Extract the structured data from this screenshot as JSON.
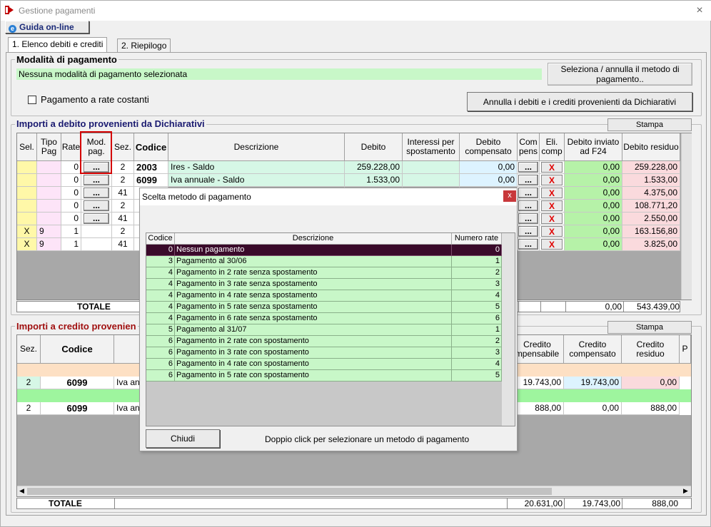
{
  "window": {
    "title": "Gestione pagamenti",
    "close_glyph": "×"
  },
  "toolbar": {
    "guida_label": "Guida on-line"
  },
  "tabs": [
    {
      "label": "1. Elenco debiti e crediti"
    },
    {
      "label": "2. Riepilogo"
    }
  ],
  "modalita": {
    "title": "Modalità di pagamento",
    "status": "Nessuna modalità di pagamento selezionata",
    "select_button": "Seleziona / annulla il metodo di pagamento..",
    "rate_costanti_label": "Pagamento a rate costanti",
    "annulla_button": "Annulla i debiti e i crediti provenienti da Dichiarativi"
  },
  "debiti": {
    "title": "Importi a debito provenienti da Dichiarativi",
    "stampa": "Stampa",
    "headers": [
      "Sel.",
      "Tipo Pag",
      "Rate",
      "Mod. pag.",
      "Sez.",
      "Codice",
      "Descrizione",
      "Debito",
      "Interessi per spostamento",
      "Debito compensato",
      "Com pens",
      "Eli. comp",
      "Debito inviato ad F24",
      "Debito residuo"
    ],
    "rows": [
      {
        "sel": "",
        "tipo": "",
        "rate": "0",
        "mod": "...",
        "sez": "2",
        "codice": "2003",
        "descr": "Ires - Saldo",
        "debito": "259.228,00",
        "compensato": "0,00",
        "inviato": "0,00",
        "residuo": "259.228,00"
      },
      {
        "sel": "",
        "tipo": "",
        "rate": "0",
        "mod": "...",
        "sez": "2",
        "codice": "6099",
        "descr": "Iva annuale - Saldo",
        "debito": "1.533,00",
        "compensato": "0,00",
        "inviato": "0,00",
        "residuo": "1.533,00"
      },
      {
        "sel": "",
        "tipo": "",
        "rate": "0",
        "mod": "...",
        "sez": "41",
        "codice": "",
        "descr": "",
        "debito": "",
        "compensato": "",
        "inviato": "0,00",
        "residuo": "4.375,00"
      },
      {
        "sel": "",
        "tipo": "",
        "rate": "0",
        "mod": "...",
        "sez": "2",
        "codice": "",
        "descr": "",
        "debito": "",
        "compensato": "",
        "inviato": "0,00",
        "residuo": "108.771,20"
      },
      {
        "sel": "",
        "tipo": "",
        "rate": "0",
        "mod": "...",
        "sez": "41",
        "codice": "",
        "descr": "",
        "debito": "",
        "compensato": "",
        "inviato": "0,00",
        "residuo": "2.550,00"
      },
      {
        "sel": "X",
        "tipo": "9",
        "rate": "1",
        "mod": "",
        "sez": "2",
        "codice": "",
        "descr": "",
        "debito": "",
        "compensato": "",
        "inviato": "0,00",
        "residuo": "163.156,80"
      },
      {
        "sel": "X",
        "tipo": "9",
        "rate": "1",
        "mod": "",
        "sez": "41",
        "codice": "",
        "descr": "",
        "debito": "",
        "compensato": "",
        "inviato": "0,00",
        "residuo": "3.825,00"
      }
    ],
    "compens_label": "...",
    "elimina_label": "X",
    "totale_label": "TOTALE",
    "totale_inviato": "0,00",
    "totale_residuo": "543.439,00"
  },
  "crediti": {
    "title": "Importi a credito provenien",
    "stampa": "Stampa",
    "headers": [
      "Sez.",
      "Codice",
      "Credito compensabile",
      "Credito compensato",
      "Credito residuo",
      "P"
    ],
    "header_compensabile_visible": "Credito mpensabile",
    "rows": [
      {
        "sez": "2",
        "codice": "6099",
        "descr": "Iva an",
        "compensabile": "19.743,00",
        "compensato": "19.743,00",
        "residuo": "0,00"
      },
      {
        "sez": "2",
        "codice": "6099",
        "descr": "Iva an",
        "compensabile": "888,00",
        "compensato": "0,00",
        "residuo": "888,00"
      }
    ],
    "totale_label": "TOTALE",
    "totale_compensabile": "20.631,00",
    "totale_compensato": "19.743,00",
    "totale_residuo": "888,00"
  },
  "modal": {
    "title": "Scelta metodo di pagamento",
    "close_glyph": "x",
    "headers": [
      "Codice",
      "Descrizione",
      "Numero rate"
    ],
    "rows": [
      {
        "codice": "0",
        "descr": "Nessun pagamento",
        "rate": "0"
      },
      {
        "codice": "3",
        "descr": "Pagamento al 30/06",
        "rate": "1"
      },
      {
        "codice": "4",
        "descr": "Pagamento in 2  rate senza spostamento",
        "rate": "2"
      },
      {
        "codice": "4",
        "descr": "Pagamento in 3  rate senza spostamento",
        "rate": "3"
      },
      {
        "codice": "4",
        "descr": "Pagamento in 4  rate senza spostamento",
        "rate": "4"
      },
      {
        "codice": "4",
        "descr": "Pagamento in 5  rate senza spostamento",
        "rate": "5"
      },
      {
        "codice": "4",
        "descr": "Pagamento in 6  rate senza spostamento",
        "rate": "6"
      },
      {
        "codice": "5",
        "descr": "Pagamento al 31/07",
        "rate": "1"
      },
      {
        "codice": "6",
        "descr": "Pagamento in 2 rate con spostamento",
        "rate": "2"
      },
      {
        "codice": "6",
        "descr": "Pagamento in 3 rate con spostamento",
        "rate": "3"
      },
      {
        "codice": "6",
        "descr": "Pagamento in 4 rate con  spostamento",
        "rate": "4"
      },
      {
        "codice": "6",
        "descr": "Pagamento in 5 rate con spostamento",
        "rate": "5"
      }
    ],
    "close_button": "Chiudi",
    "hint": "Doppio click per selezionare un metodo di pagamento"
  }
}
